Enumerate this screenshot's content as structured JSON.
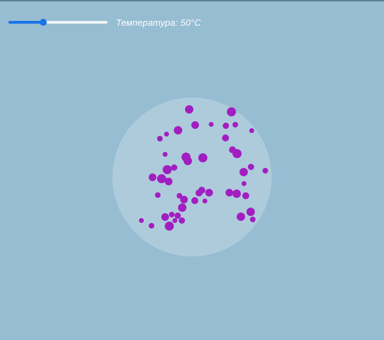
{
  "controls": {
    "temperature_label": "Температура: 50°C",
    "temperature_value": 50,
    "slider_fraction": 0.35
  },
  "colors": {
    "background": "#96bdd2",
    "dish": "#aecbdc",
    "molecule": "#a21ec0",
    "slider_accent": "#1a73e8"
  }
}
